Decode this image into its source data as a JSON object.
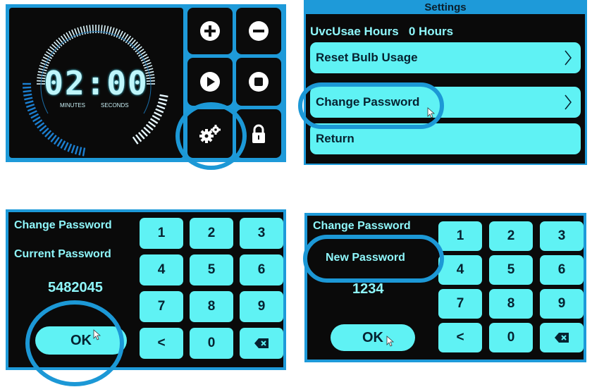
{
  "timer": {
    "display": "02:00",
    "minutes_label": "MINUTES",
    "seconds_label": "SECONDS",
    "buttons": [
      {
        "name": "plus-button",
        "icon": "plus-circle-icon"
      },
      {
        "name": "minus-button",
        "icon": "minus-circle-icon"
      },
      {
        "name": "play-button",
        "icon": "play-circle-icon"
      },
      {
        "name": "stop-button",
        "icon": "stop-circle-icon"
      },
      {
        "name": "settings-button",
        "icon": "gears-icon"
      },
      {
        "name": "lock-button",
        "icon": "lock-icon"
      }
    ]
  },
  "settings": {
    "title": "Settings",
    "usage_text": "UvcUsae Hours   0 Hours",
    "reset_label": "Reset Bulb Usage",
    "change_password_label": "Change Password",
    "return_label": "Return"
  },
  "keypad_current": {
    "title": "Change Password",
    "subtitle": "Current Password",
    "value": "5482045",
    "ok_label": "OK",
    "keys": [
      "1",
      "2",
      "3",
      "4",
      "5",
      "6",
      "7",
      "8",
      "9",
      "<",
      "0"
    ]
  },
  "keypad_new": {
    "title": "Change Password",
    "subtitle": "New Password",
    "value": "1234",
    "ok_label": "OK",
    "keys": [
      "1",
      "2",
      "3",
      "4",
      "5",
      "6",
      "7",
      "8",
      "9",
      "<",
      "0"
    ]
  },
  "colors": {
    "accent_blue": "#1e9ad9",
    "cyan_button": "#5ff2f4",
    "cyan_text": "#8ff7fb",
    "background": "#0a0a0a"
  }
}
